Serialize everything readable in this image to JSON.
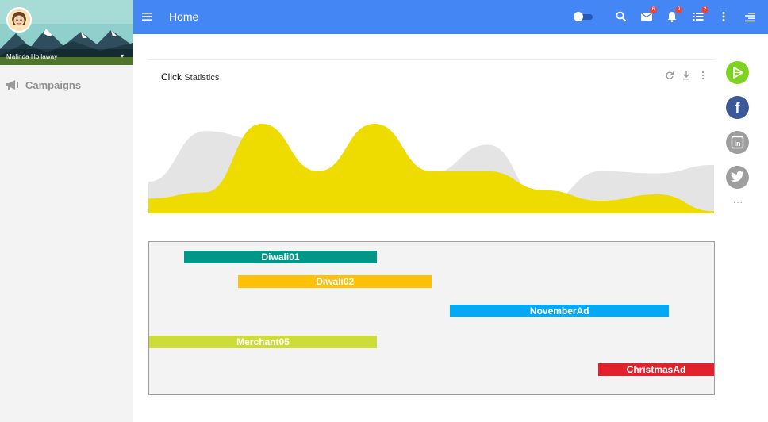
{
  "user": {
    "name": "Malinda Hollaway"
  },
  "sidebar": {
    "items": [
      {
        "label": "Campaigns",
        "icon": "megaphone-icon"
      }
    ]
  },
  "header": {
    "title": "Home",
    "badges": {
      "mail": "6",
      "notifications": "9",
      "tasks": "2"
    },
    "toggle_on": true
  },
  "chart_card": {
    "title": "Click",
    "subtitle": "Statistics",
    "actions": [
      "refresh-icon",
      "download-icon",
      "more-vert-icon"
    ]
  },
  "chart_data": {
    "type": "area",
    "title": "Click Statistics",
    "xlabel": "",
    "ylabel": "",
    "grid": false,
    "series": [
      {
        "color": "#e4e4e4",
        "values": [
          30,
          78,
          70,
          38,
          20,
          38,
          65,
          10,
          40,
          38,
          46
        ]
      },
      {
        "color": "#eedc00",
        "values": [
          14,
          20,
          85,
          40,
          85,
          40,
          40,
          22,
          12,
          18,
          2
        ]
      }
    ]
  },
  "timeline": {
    "bars": [
      {
        "label": "Diwali01",
        "color": "#009688",
        "start": 0.062,
        "end": 0.403,
        "row": 0
      },
      {
        "label": "Diwali02",
        "color": "#ffc107",
        "start": 0.158,
        "end": 0.5,
        "row": 1
      },
      {
        "label": "NovemberAd",
        "color": "#03a9f4",
        "start": 0.533,
        "end": 0.92,
        "row": 2
      },
      {
        "label": "Merchant05",
        "color": "#cddc39",
        "start": 0.0,
        "end": 0.403,
        "row": 3
      },
      {
        "label": "ChristmasAd",
        "color": "#e3212d",
        "start": 0.795,
        "end": 1.0,
        "row": 4
      }
    ]
  },
  "social": [
    "play-store-icon",
    "facebook-icon",
    "linkedin-icon",
    "twitter-icon"
  ],
  "colors": {
    "header": "#4486f4",
    "accent_green": "#7ed321",
    "facebook": "#3b5998",
    "muted_grey": "#9e9e9e"
  }
}
